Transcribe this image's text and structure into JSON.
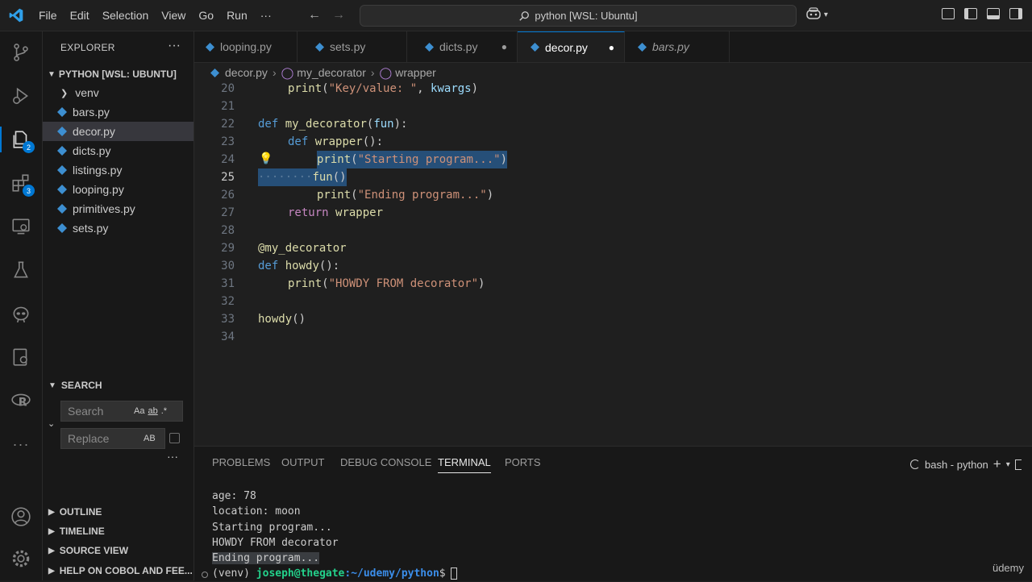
{
  "menu": [
    "File",
    "Edit",
    "Selection",
    "View",
    "Go",
    "Run",
    "···"
  ],
  "command_center": "python [WSL: Ubuntu]",
  "explorer": {
    "title": "EXPLORER",
    "folder": "PYTHON [WSL: UBUNTU]",
    "items": [
      {
        "label": "venv",
        "kind": "folder"
      },
      {
        "label": "bars.py",
        "kind": "file"
      },
      {
        "label": "decor.py",
        "kind": "file",
        "selected": true
      },
      {
        "label": "dicts.py",
        "kind": "file"
      },
      {
        "label": "listings.py",
        "kind": "file"
      },
      {
        "label": "looping.py",
        "kind": "file"
      },
      {
        "label": "primitives.py",
        "kind": "file"
      },
      {
        "label": "sets.py",
        "kind": "file"
      }
    ]
  },
  "search": {
    "title": "SEARCH",
    "search_placeholder": "Search",
    "replace_placeholder": "Replace",
    "opt_case": "Aa",
    "opt_word": "ab",
    "opt_regex": ".*",
    "opt_preserve": "AB"
  },
  "bottom_sections": [
    "OUTLINE",
    "TIMELINE",
    "SOURCE VIEW",
    "HELP ON COBOL AND FEE..."
  ],
  "badges": {
    "explorer": "2",
    "extensions": "3"
  },
  "tabs": [
    {
      "label": "looping.py"
    },
    {
      "label": "sets.py"
    },
    {
      "label": "dicts.py",
      "dirty": true
    },
    {
      "label": "decor.py",
      "dirty": true,
      "active": true
    },
    {
      "label": "bars.py",
      "italic": true
    }
  ],
  "breadcrumb": [
    "decor.py",
    "my_decorator",
    "wrapper"
  ],
  "code_lines": {
    "n20": "20",
    "n21": "21",
    "n22": "22",
    "n23": "23",
    "n24": "24",
    "n25": "25",
    "n26": "26",
    "n27": "27",
    "n28": "28",
    "n29": "29",
    "n30": "30",
    "n31": "31",
    "n32": "32",
    "n33": "33",
    "n34": "34"
  },
  "code": {
    "l20_print": "print",
    "l20_str": "\"Key/value: \"",
    "l20_arg": "kwargs",
    "l22_def": "def",
    "l22_name": "my_decorator",
    "l22_param": "fun",
    "l23_def": "def",
    "l23_name": "wrapper",
    "l24_print": "print",
    "l24_str": "\"Starting program...\"",
    "l25_call": "fun",
    "l26_print": "print",
    "l26_str": "\"Ending program...\"",
    "l27_ret": "return",
    "l27_val": "wrapper",
    "l29_deco": "@my_decorator",
    "l30_def": "def",
    "l30_name": "howdy",
    "l31_print": "print",
    "l31_str": "\"HOWDY FROM decorator\"",
    "l33_call": "howdy"
  },
  "panel": {
    "tabs": [
      "PROBLEMS",
      "OUTPUT",
      "DEBUG CONSOLE",
      "TERMINAL",
      "PORTS"
    ],
    "active_tab": "TERMINAL",
    "terminal_name": "bash - python"
  },
  "terminal": {
    "lines": [
      "age: 78",
      "location: moon",
      "Starting program...",
      "HOWDY FROM decorator",
      "Ending program..."
    ],
    "prompt_env": "(venv)",
    "prompt_user": "joseph@thegate",
    "prompt_path": ":~/udemy/python",
    "prompt_symbol": "$"
  },
  "watermark": "üdemy",
  "colors": {
    "accent": "#0078d4",
    "selection": "#264f78",
    "keyword": "#569cd6",
    "function": "#dcdcaa",
    "string": "#ce9178"
  }
}
